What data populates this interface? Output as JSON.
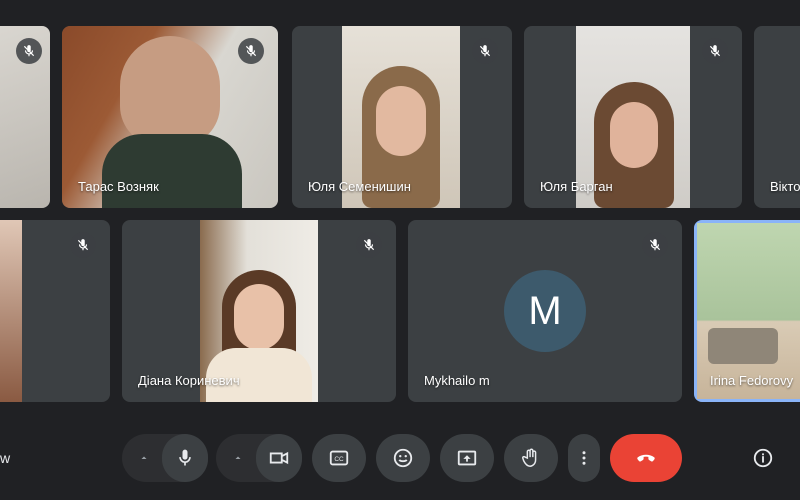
{
  "participants": [
    {
      "name": "",
      "muted": true
    },
    {
      "name": "Тарас Возняк",
      "muted": true
    },
    {
      "name": "Юля Семенишин",
      "muted": true
    },
    {
      "name": "Юля Барган",
      "muted": true
    },
    {
      "name": "Вікто",
      "muted": false
    },
    {
      "name": "",
      "muted": true
    },
    {
      "name": "Діана Кориневич",
      "muted": true
    },
    {
      "name": "Mykhailo m",
      "muted": true,
      "avatar_letter": "M"
    },
    {
      "name": "Irina Fedorovy",
      "muted": false
    }
  ],
  "left_cutoff_text": "w",
  "toolbar": {
    "buttons": [
      "mic",
      "camera",
      "captions",
      "emoji",
      "present",
      "raise-hand",
      "more",
      "end-call"
    ]
  },
  "colors": {
    "accent": "#8ab4f8",
    "hangup": "#ea4335",
    "tile": "#3c4043",
    "background": "#202124"
  }
}
